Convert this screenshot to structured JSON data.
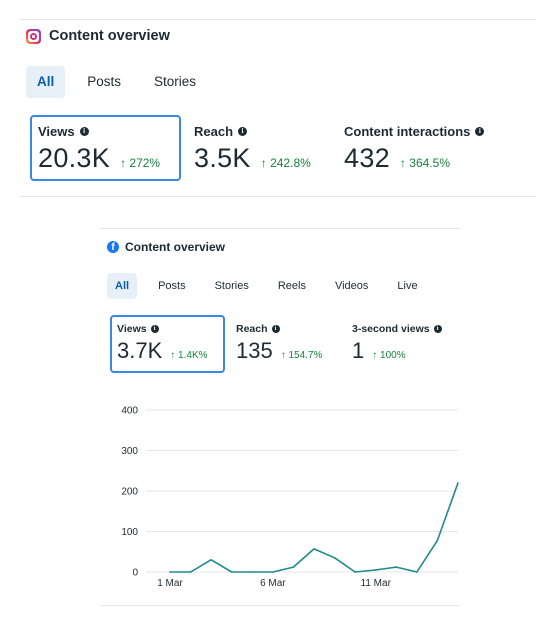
{
  "instagram": {
    "title": "Content overview",
    "logo_icon": "instagram-icon",
    "tabs": [
      {
        "label": "All",
        "active": true
      },
      {
        "label": "Posts",
        "active": false
      },
      {
        "label": "Stories",
        "active": false
      }
    ],
    "metrics": [
      {
        "label": "Views",
        "value": "20.3K",
        "change": "↑ 272%",
        "selected": true
      },
      {
        "label": "Reach",
        "value": "3.5K",
        "change": "↑ 242.8%",
        "selected": false
      },
      {
        "label": "Content interactions",
        "value": "432",
        "change": "↑ 364.5%",
        "selected": false
      }
    ]
  },
  "facebook": {
    "title": "Content overview",
    "logo_icon": "facebook-icon",
    "tabs": [
      {
        "label": "All",
        "active": true
      },
      {
        "label": "Posts",
        "active": false
      },
      {
        "label": "Stories",
        "active": false
      },
      {
        "label": "Reels",
        "active": false
      },
      {
        "label": "Videos",
        "active": false
      },
      {
        "label": "Live",
        "active": false
      }
    ],
    "metrics": [
      {
        "label": "Views",
        "value": "3.7K",
        "change": "↑ 1.4K%",
        "selected": true
      },
      {
        "label": "Reach",
        "value": "135",
        "change": "↑ 154.7%",
        "selected": false
      },
      {
        "label": "3-second views",
        "value": "1",
        "change": "↑ 100%",
        "selected": false
      }
    ]
  },
  "colors": {
    "accent": "#3b8ad9",
    "active_tab_bg": "#e7f0f9",
    "active_tab_text": "#0a5fa8",
    "positive_change": "#16843c",
    "line": "#1e8a8a",
    "gridline": "#e4e6eb"
  },
  "chart_data": {
    "type": "line",
    "x": [
      1,
      2,
      3,
      4,
      5,
      6,
      7,
      8,
      9,
      10,
      11,
      12,
      13,
      14,
      15
    ],
    "x_tick_labels": [
      "1 Mar",
      "6 Mar",
      "11 Mar"
    ],
    "x_tick_positions": [
      1,
      6,
      11
    ],
    "series": [
      {
        "values": [
          0,
          0,
          30,
          0,
          0,
          0,
          12,
          57,
          35,
          0,
          5,
          12,
          0,
          78,
          220
        ]
      }
    ],
    "yticks": [
      0,
      100,
      200,
      300,
      400
    ],
    "ylim": [
      0,
      400
    ],
    "grid": true
  }
}
